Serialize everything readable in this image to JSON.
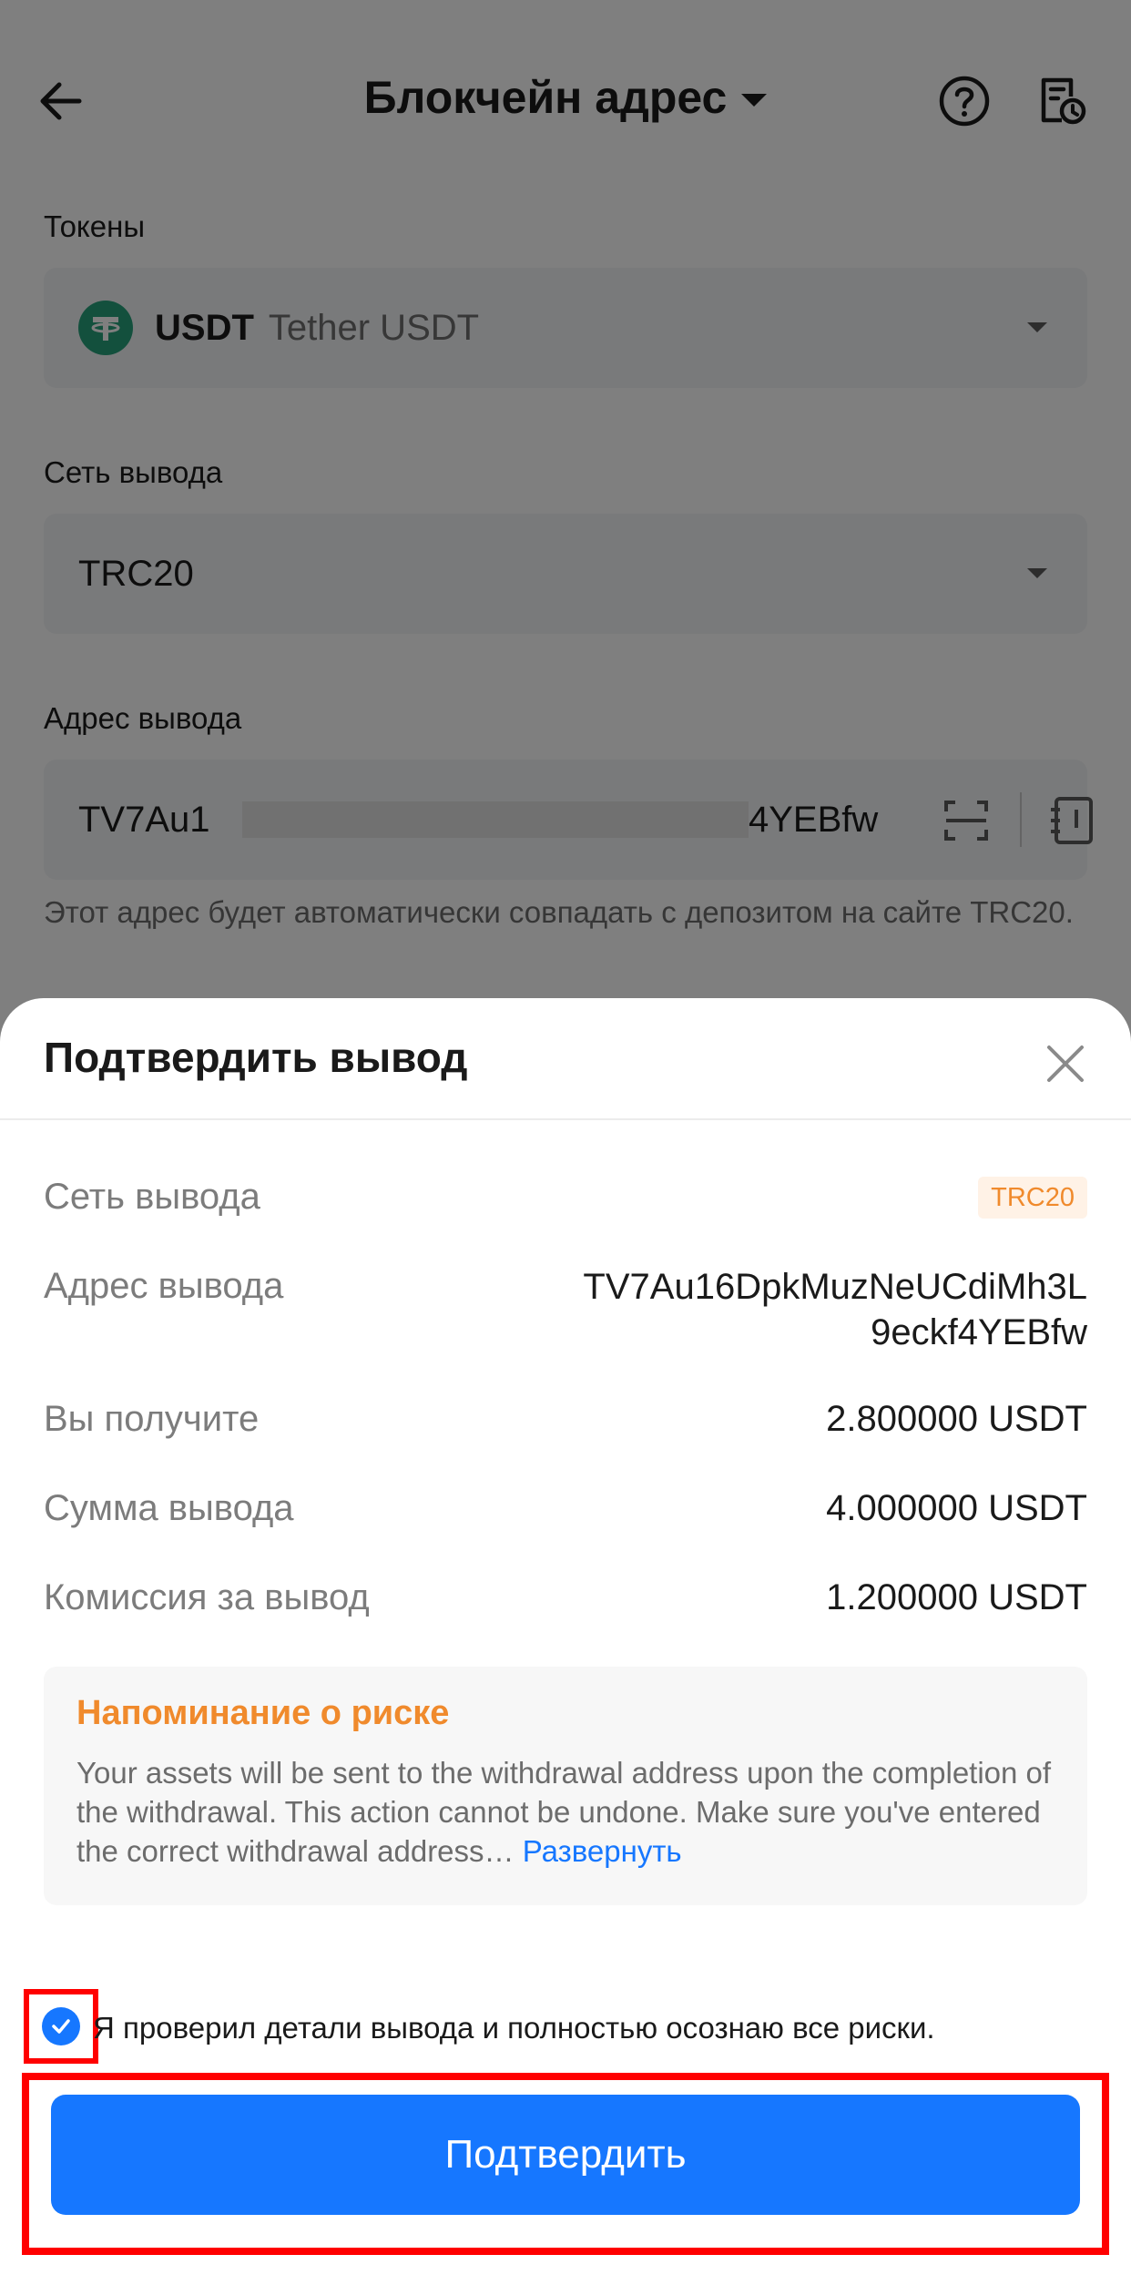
{
  "header": {
    "title": "Блокчейн адрес"
  },
  "form": {
    "token_label": "Токены",
    "token_symbol": "USDT",
    "token_name": "Tether USDT",
    "network_label": "Сеть вывода",
    "network_value": "TRC20",
    "address_label": "Адрес вывода",
    "address_prefix": "TV7Au1",
    "address_suffix": "4YEBfw",
    "address_hint": "Этот адрес будет автоматически совпадать с депозитом на сайте TRC20."
  },
  "sheet": {
    "title": "Подтвердить вывод",
    "rows": {
      "network_label": "Сеть вывода",
      "network_badge": "TRC20",
      "address_label": "Адрес вывода",
      "address_value": "TV7Au16DpkMuzNeUCdiMh3L9eckf4YEBfw",
      "receive_label": "Вы получите",
      "receive_value": "2.800000 USDT",
      "amount_label": "Сумма вывода",
      "amount_value": "4.000000 USDT",
      "fee_label": "Комиссия за вывод",
      "fee_value": "1.200000 USDT"
    },
    "risk": {
      "title": "Напоминание о риске",
      "text": "Your assets will be sent to the withdrawal address upon the completion of the withdrawal. This action cannot be undone. Make sure you've entered the correct withdrawal address…",
      "more": "Развернуть"
    },
    "agreement": "Я проверил детали вывода и полностью осознаю все риски.",
    "confirm_label": "Подтвердить"
  },
  "colors": {
    "accent": "#1677ff",
    "warning": "#f08a2c",
    "highlight": "#ff0000",
    "tether": "#26a17b"
  },
  "icons": {
    "back": "arrow-left-icon",
    "help": "question-circle-icon",
    "history": "history-document-icon",
    "scan": "scan-icon",
    "address_book": "address-book-icon",
    "close": "close-icon",
    "check": "check-icon"
  }
}
